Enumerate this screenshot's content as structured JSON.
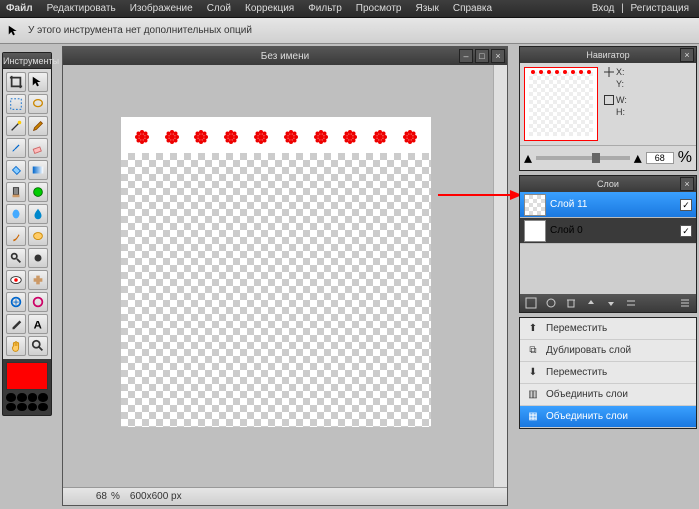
{
  "menu": {
    "items": [
      "Файл",
      "Редактировать",
      "Изображение",
      "Слой",
      "Коррекция",
      "Фильтр",
      "Просмотр",
      "Язык",
      "Справка"
    ],
    "login": "Вход",
    "register": "Регистрация"
  },
  "optbar": {
    "text": "У этого инструмента нет дополнительных опций"
  },
  "toolbox": {
    "title": "Инструменты"
  },
  "document": {
    "title": "Без имени",
    "zoom": "68",
    "pct": "%",
    "dims": "600x600 px"
  },
  "navigator": {
    "title": "Навигатор",
    "x": "X:",
    "y": "Y:",
    "w": "W:",
    "h": "H:",
    "zoom": "68",
    "pct": "%"
  },
  "layers": {
    "title": "Слои",
    "items": [
      {
        "name": "Слой 11",
        "selected": true,
        "visible": true,
        "solid": false
      },
      {
        "name": "Слой 0",
        "selected": false,
        "visible": true,
        "solid": true
      }
    ]
  },
  "context": {
    "items": [
      {
        "label": "Переместить",
        "selected": false
      },
      {
        "label": "Дублировать слой",
        "selected": false
      },
      {
        "label": "Переместить",
        "selected": false
      },
      {
        "label": "Объединить слои",
        "selected": false
      },
      {
        "label": "Объединить слои",
        "selected": true
      }
    ]
  },
  "colors": {
    "foreground": "#ff0000"
  }
}
